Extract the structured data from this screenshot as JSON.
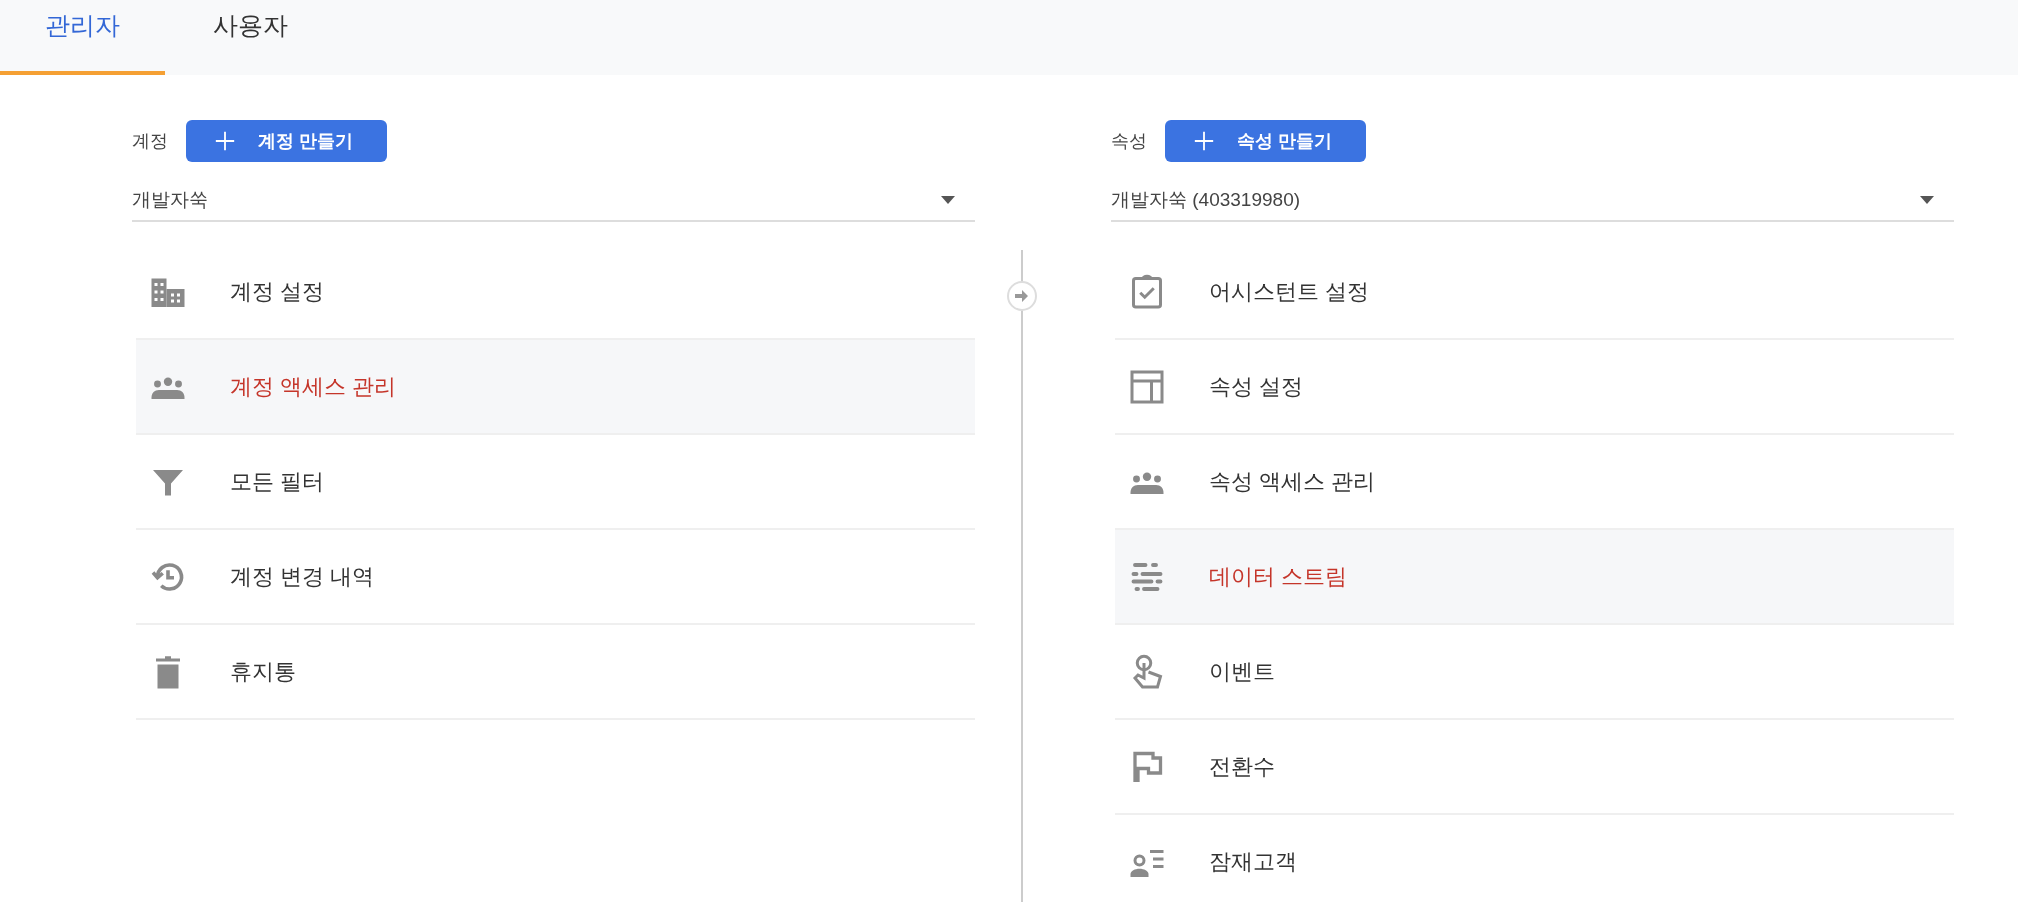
{
  "tabs": [
    {
      "label": "관리자",
      "selected": true
    },
    {
      "label": "사용자",
      "selected": false
    }
  ],
  "columns": [
    {
      "label": "계정",
      "create_button": "계정 만들기",
      "select_value": "개발자쑥",
      "items": [
        {
          "label": "계정 설정",
          "kind": "building",
          "selected": false
        },
        {
          "label": "계정 액세스 관리",
          "kind": "people",
          "selected": true
        },
        {
          "label": "모든 필터",
          "kind": "filter",
          "selected": false
        },
        {
          "label": "계정 변경 내역",
          "kind": "history",
          "selected": false
        },
        {
          "label": "휴지통",
          "kind": "trash",
          "selected": false
        }
      ]
    },
    {
      "label": "속성",
      "create_button": "속성 만들기",
      "select_value": "개발자쑥 (403319980)",
      "items": [
        {
          "label": "어시스턴트 설정",
          "kind": "clipboard",
          "selected": false
        },
        {
          "label": "속성 설정",
          "kind": "layout",
          "selected": false
        },
        {
          "label": "속성 액세스 관리",
          "kind": "people",
          "selected": false
        },
        {
          "label": "데이터 스트림",
          "kind": "stream",
          "selected": true
        },
        {
          "label": "이벤트",
          "kind": "touch",
          "selected": false
        },
        {
          "label": "전환수",
          "kind": "flag",
          "selected": false
        },
        {
          "label": "잠재고객",
          "kind": "audience",
          "selected": false
        }
      ]
    }
  ]
}
